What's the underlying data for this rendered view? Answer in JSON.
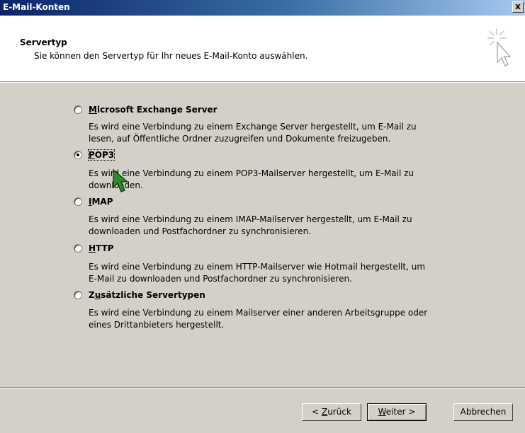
{
  "window": {
    "title": "E-Mail-Konten",
    "close_label": "x"
  },
  "header": {
    "title": "Servertyp",
    "subtitle": "Sie können den Servertyp für Ihr neues E-Mail-Konto auswählen."
  },
  "options": [
    {
      "label_first": "M",
      "label_rest": "icrosoft Exchange Server",
      "selected": false,
      "desc": [
        "Es wird eine Verbindung zu einem Exchange Server hergestellt, um E-Mail zu",
        "lesen, auf Öffentliche Ordner zuzugreifen und Dokumente freizugeben."
      ]
    },
    {
      "label_first": "P",
      "label_rest": "OP3",
      "selected": true,
      "desc": [
        "Es wird eine Verbindung zu einem POP3-Mailserver hergestellt, um E-Mail zu",
        "downloaden."
      ]
    },
    {
      "label_first": "I",
      "label_rest": "MAP",
      "selected": false,
      "desc": [
        "Es wird eine Verbindung zu einem IMAP-Mailserver hergestellt, um E-Mail zu",
        "downloaden und Postfachordner zu synchronisieren."
      ]
    },
    {
      "label_first": "H",
      "label_rest": "TTP",
      "selected": false,
      "desc": [
        "Es wird eine Verbindung zu einem HTTP-Mailserver wie Hotmail hergestellt, um",
        "E-Mail zu downloaden und Postfachordner zu synchronisieren."
      ]
    },
    {
      "label_pre": "Z",
      "label_first": "u",
      "label_rest": "sätzliche Servertypen",
      "selected": false,
      "desc": [
        "Es wird eine Verbindung zu einem Mailserver einer anderen Arbeitsgruppe oder",
        "eines Drittanbieters hergestellt."
      ]
    }
  ],
  "buttons": {
    "back_pre": "< ",
    "back_first": "Z",
    "back_rest": "urück",
    "next_first": "W",
    "next_rest": "eiter >",
    "cancel": "Abbrechen"
  },
  "icons": {
    "wizard": "wizard-sparkle-cursor-icon",
    "pointer": "mouse-pointer-icon"
  },
  "colors": {
    "title_bar_start": "#0a246a",
    "title_bar_end": "#a6caf0",
    "dialog_bg": "#d4d0c8",
    "header_bg": "#ffffff",
    "cursor_fill": "#2e8b2e"
  }
}
